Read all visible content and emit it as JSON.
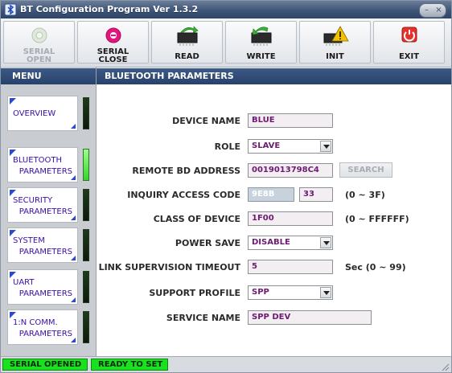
{
  "window": {
    "title": "BT Configuration Program Ver 1.3.2",
    "app_icon": "bluetooth-app-icon",
    "controls": {
      "minimize": "–",
      "close": "×"
    }
  },
  "toolbar": {
    "buttons": [
      {
        "label": "SERIAL OPEN",
        "line1": "SERIAL",
        "line2": "OPEN",
        "icon": "plug-icon",
        "enabled": false
      },
      {
        "label": "SERIAL CLOSE",
        "line1": "SERIAL",
        "line2": "CLOSE",
        "icon": "disconnect-icon",
        "enabled": true
      },
      {
        "label": "READ",
        "icon": "chip-read-icon",
        "enabled": true
      },
      {
        "label": "WRITE",
        "icon": "chip-write-icon",
        "enabled": true
      },
      {
        "label": "INIT",
        "icon": "chip-warning-icon",
        "enabled": true
      },
      {
        "label": "EXIT",
        "icon": "power-icon",
        "enabled": true
      }
    ]
  },
  "menu": {
    "title": "MENU",
    "items": [
      {
        "line1": "OVERVIEW",
        "line2": "",
        "active": false
      },
      {
        "line1": "BLUETOOTH",
        "line2": "PARAMETERS",
        "active": true
      },
      {
        "line1": "SECURITY",
        "line2": "PARAMETERS",
        "active": false
      },
      {
        "line1": "SYSTEM",
        "line2": "PARAMETERS",
        "active": false
      },
      {
        "line1": "UART",
        "line2": "PARAMETERS",
        "active": false
      },
      {
        "line1": "1:N COMM.",
        "line2": "PARAMETERS",
        "active": false
      }
    ]
  },
  "panel": {
    "title": "BLUETOOTH PARAMETERS",
    "device_name": {
      "label": "DEVICE NAME",
      "value": "BLUE"
    },
    "role": {
      "label": "ROLE",
      "value": "SLAVE"
    },
    "remote_bd_address": {
      "label": "REMOTE BD ADDRESS",
      "value": "0019013798C4",
      "search_label": "SEARCH"
    },
    "inquiry_access_code": {
      "label": "INQUIRY ACCESS CODE",
      "value_prefix": "9E8B",
      "value": "33",
      "range": "(0 ~ 3F)"
    },
    "class_of_device": {
      "label": "CLASS OF DEVICE",
      "value": "1F00",
      "range": "(0 ~ FFFFFF)"
    },
    "power_save": {
      "label": "POWER SAVE",
      "value": "DISABLE"
    },
    "link_supervision_timeout": {
      "label": "LINK SUPERVISION TIMEOUT",
      "value": "5",
      "range": "Sec (0 ~ 99)"
    },
    "support_profile": {
      "label": "SUPPORT PROFILE",
      "value": "SPP"
    },
    "service_name": {
      "label": "SERVICE NAME",
      "value": "SPP DEV"
    }
  },
  "status": {
    "serial": "SERIAL OPENED",
    "state": "READY TO SET"
  },
  "colors": {
    "accent_header": "#2f4b76",
    "value_text": "#6d1a72",
    "status_green": "#18e21e",
    "menu_text": "#3a0ea8"
  }
}
